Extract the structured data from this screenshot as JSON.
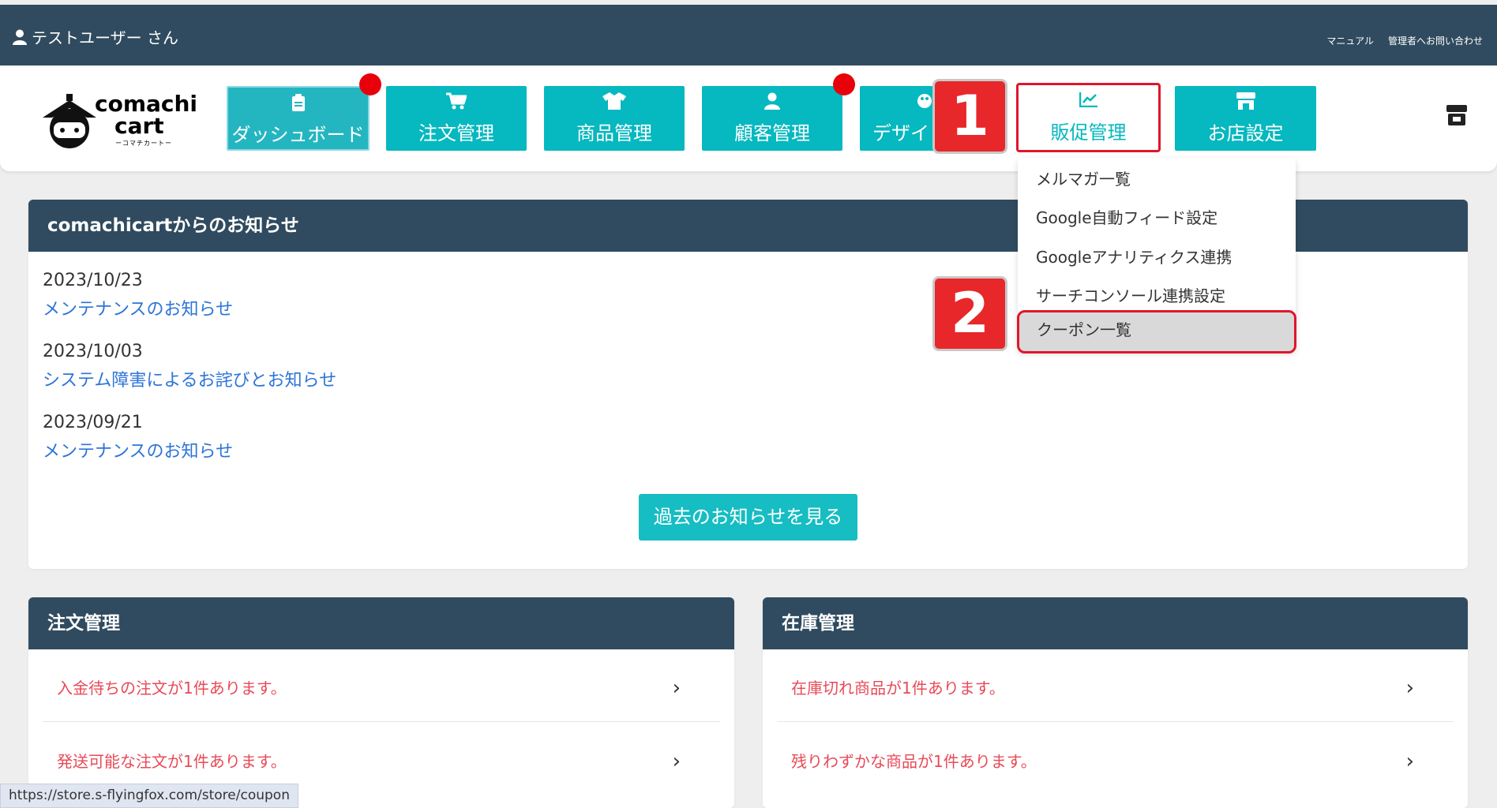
{
  "topbar": {
    "user_name": "テストユーザー さん",
    "links": [
      "マニュアル",
      "管理者へお問い合わせ"
    ]
  },
  "logo": {
    "line1": "comachi",
    "line2": "cart",
    "line3": "ーコマチカートー"
  },
  "nav": {
    "dashboard": "ダッシュボード",
    "orders": "注文管理",
    "products": "商品管理",
    "customers": "顧客管理",
    "design": "デザイ",
    "promotion": "販促管理",
    "store_settings": "お店設定"
  },
  "callouts": {
    "one": "1",
    "two": "2"
  },
  "dropdown": {
    "items": [
      "メルマガ一覧",
      "Google自動フィード設定",
      "Googleアナリティクス連携",
      "サーチコンソール連携設定",
      "クーポン一覧"
    ]
  },
  "notices": {
    "title": "comachicartからのお知らせ",
    "items": [
      {
        "date": "2023/10/23",
        "title": "メンテナンスのお知らせ"
      },
      {
        "date": "2023/10/03",
        "title": "システム障害によるお詫びとお知らせ"
      },
      {
        "date": "2023/09/21",
        "title": "メンテナンスのお知らせ"
      }
    ],
    "more_button": "過去のお知らせを見る"
  },
  "orders_card": {
    "title": "注文管理",
    "rows": [
      "入金待ちの注文が1件あります。",
      "発送可能な注文が1件あります。"
    ]
  },
  "stock_card": {
    "title": "在庫管理",
    "rows": [
      "在庫切れ商品が1件あります。",
      "残りわずかな商品が1件あります。"
    ]
  },
  "status_url": "https://store.s-flyingfox.com/store/coupon",
  "colors": {
    "header": "#304b5f",
    "teal": "#06b8bf",
    "highlight": "#e0162b",
    "notice_link": "#2d74d8",
    "alert_text": "#e84a57"
  }
}
